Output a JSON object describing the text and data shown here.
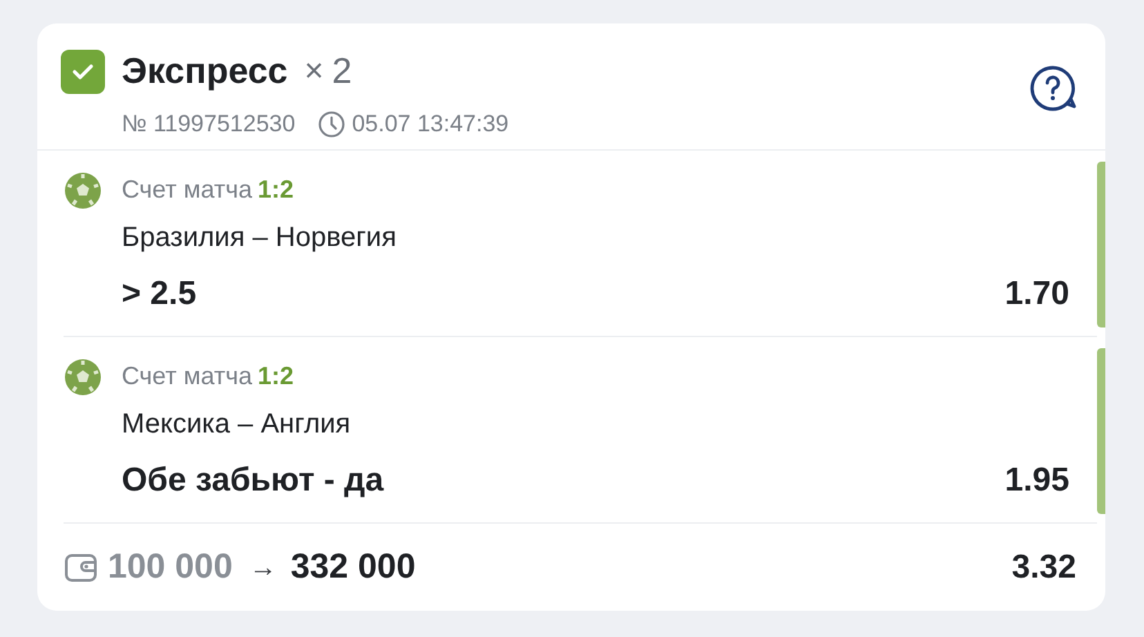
{
  "header": {
    "checked": true,
    "title": "Экспресс",
    "multiplier_sign": "×",
    "multiplier": "2",
    "number": "№ 11997512530",
    "datetime": "05.07 13:47:39"
  },
  "events": [
    {
      "label": "Счет матча",
      "score": "1:2",
      "teams": "Бразилия – Норвегия",
      "pick": "> 2.5",
      "odds": "1.70",
      "won": true
    },
    {
      "label": "Счет матча",
      "score": "1:2",
      "teams": "Мексика – Англия",
      "pick": "Обе забьют - да",
      "odds": "1.95",
      "won": true
    }
  ],
  "footer": {
    "stake": "100 000",
    "arrow": "→",
    "payout": "332 000",
    "total_odds": "3.32"
  }
}
